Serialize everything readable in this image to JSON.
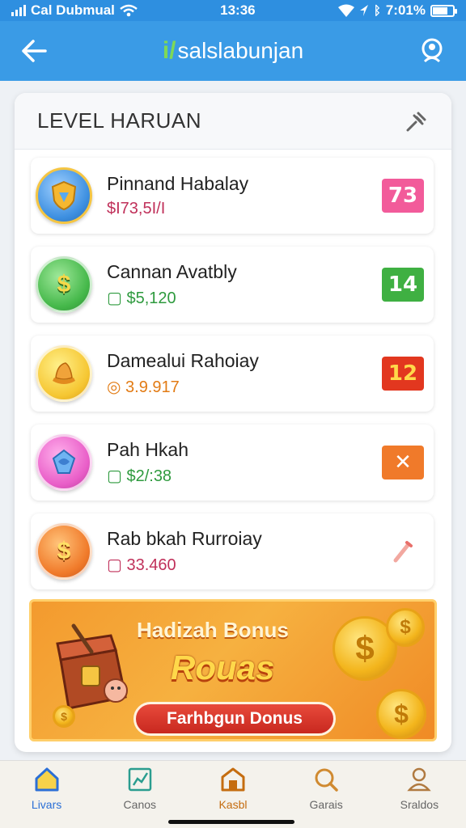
{
  "status_bar": {
    "carrier": "Cal Dubmual",
    "time": "13:36",
    "battery": "7:01%"
  },
  "app_bar": {
    "logo_glyph": "i/",
    "title": "salslabunjan"
  },
  "card": {
    "title": "LEVEL HARUAN"
  },
  "items": [
    {
      "name": "Pinnand Habalay",
      "value": "$I73,5I/I",
      "value_color": "#c0305a",
      "badge": "73",
      "badge_color": "#f25b9a",
      "coin_color": "#3d8fe0",
      "icon": "shield-icon",
      "glyph": "◆"
    },
    {
      "name": "Cannan Avatbly",
      "value": "▢ $5,120",
      "value_color": "#2e9a3e",
      "badge": "14",
      "badge_color": "#3fb042",
      "coin_color": "#45b84a",
      "icon": "dollar-coin-icon",
      "glyph": "$"
    },
    {
      "name": "Damealui Rahoiay",
      "value": "◎ 3.9.917",
      "value_color": "#e27b14",
      "badge": "12",
      "badge_color": "#e2371f",
      "coin_color": "#f6c733",
      "icon": "hat-icon",
      "glyph": "♛"
    },
    {
      "name": "Pah Hkah",
      "value": "▢ $2/:38",
      "value_color": "#2e9a3e",
      "badge": "✕",
      "badge_color": "#f07a2a",
      "coin_color": "#e95ec8",
      "icon": "gem-icon",
      "glyph": "✦"
    },
    {
      "name": "Rab bkah Rurroiay",
      "value": "▢ 33.460",
      "value_color": "#c0305a",
      "badge": "",
      "badge_color": "",
      "coin_color": "#f07a2a",
      "icon": "dollar-coin-icon",
      "glyph": "$"
    }
  ],
  "banner": {
    "line1": "Hadizah Bonus",
    "line2": "Rouas",
    "button": "Farhbgun Donus"
  },
  "bottom_nav": [
    {
      "label": "Livars",
      "icon": "home-icon",
      "color": "#2b6fd6"
    },
    {
      "label": "Canos",
      "icon": "chart-icon",
      "color": "#666666"
    },
    {
      "label": "Kasbl",
      "icon": "shop-icon",
      "color": "#c56d10"
    },
    {
      "label": "Garais",
      "icon": "search-icon",
      "color": "#666666"
    },
    {
      "label": "Sraldos",
      "icon": "profile-icon",
      "color": "#666666"
    }
  ]
}
